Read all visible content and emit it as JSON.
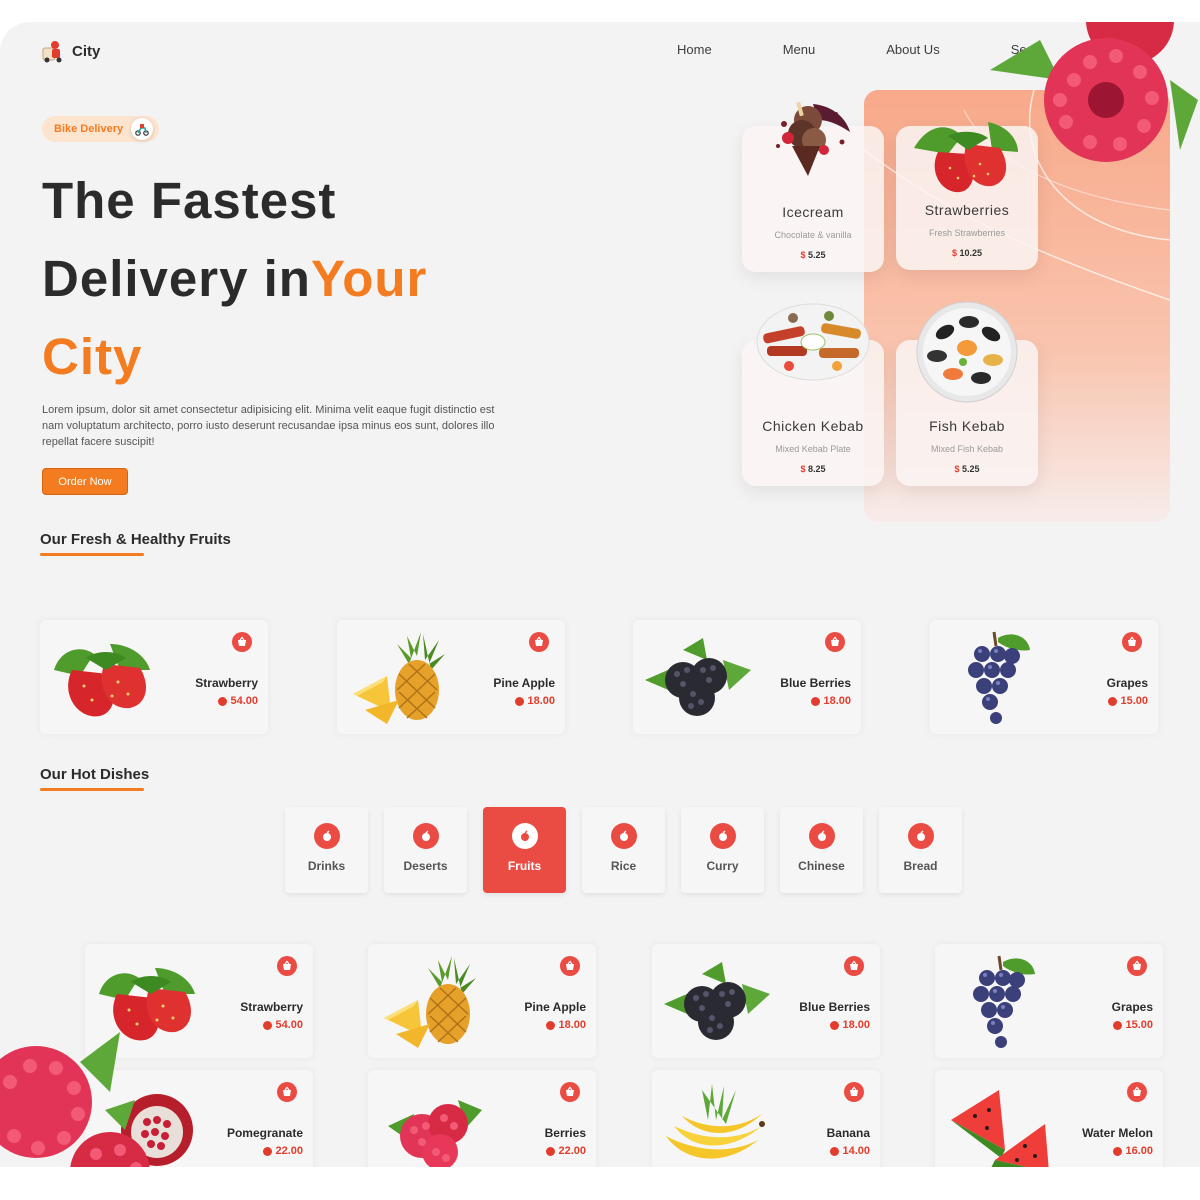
{
  "brand": {
    "name": "City"
  },
  "nav": {
    "items": [
      "Home",
      "Menu",
      "About Us",
      "Se"
    ]
  },
  "hero": {
    "badge": "Bike Delivery",
    "title_line1": "The Fastest",
    "title_line2_a": "Delivery in",
    "title_line2_b": "Your",
    "title_line3": "City",
    "description": "Lorem ipsum, dolor sit amet consectetur adipisicing elit. Minima velit eaque fugit distinctio est nam voluptatum architecto, porro iusto deserunt recusandae ipsa minus eos sunt, dolores illo repellat facere suscipit!",
    "cta": "Order Now"
  },
  "hero_cards": [
    {
      "name": "Icecream",
      "sub": "Chocolate & vanilla",
      "currency": "$",
      "price": "5.25"
    },
    {
      "name": "Strawberries",
      "sub": "Fresh Strawberries",
      "currency": "$",
      "price": "10.25"
    },
    {
      "name": "Chicken Kebab",
      "sub": "Mixed Kebab Plate",
      "currency": "$",
      "price": "8.25"
    },
    {
      "name": "Fish Kebab",
      "sub": "Mixed Fish Kebab",
      "currency": "$",
      "price": "5.25"
    }
  ],
  "fruits_section": {
    "title": "Our Fresh & Healthy Fruits",
    "items": [
      {
        "name": "Strawberry",
        "price": "54.00",
        "icon": "strawberry"
      },
      {
        "name": "Pine Apple",
        "price": "18.00",
        "icon": "pineapple"
      },
      {
        "name": "Blue Berries",
        "price": "18.00",
        "icon": "blackberries"
      },
      {
        "name": "Grapes",
        "price": "15.00",
        "icon": "grapes"
      }
    ]
  },
  "dishes_section": {
    "title": "Our Hot Dishes",
    "categories": [
      "Drinks",
      "Deserts",
      "Fruits",
      "Rice",
      "Curry",
      "Chinese",
      "Bread"
    ],
    "active_category": "Fruits",
    "items": [
      {
        "name": "Strawberry",
        "price": "54.00",
        "icon": "strawberry"
      },
      {
        "name": "Pine Apple",
        "price": "18.00",
        "icon": "pineapple"
      },
      {
        "name": "Blue Berries",
        "price": "18.00",
        "icon": "blackberries"
      },
      {
        "name": "Grapes",
        "price": "15.00",
        "icon": "grapes"
      },
      {
        "name": "Pomegranate",
        "price": "22.00",
        "icon": "pomegranate"
      },
      {
        "name": "Berries",
        "price": "22.00",
        "icon": "raspberries"
      },
      {
        "name": "Banana",
        "price": "14.00",
        "icon": "banana"
      },
      {
        "name": "Water Melon",
        "price": "16.00",
        "icon": "watermelon"
      }
    ]
  },
  "colors": {
    "accent": "#f47c20",
    "red": "#ea4c43",
    "background": "#f4f3f3"
  }
}
